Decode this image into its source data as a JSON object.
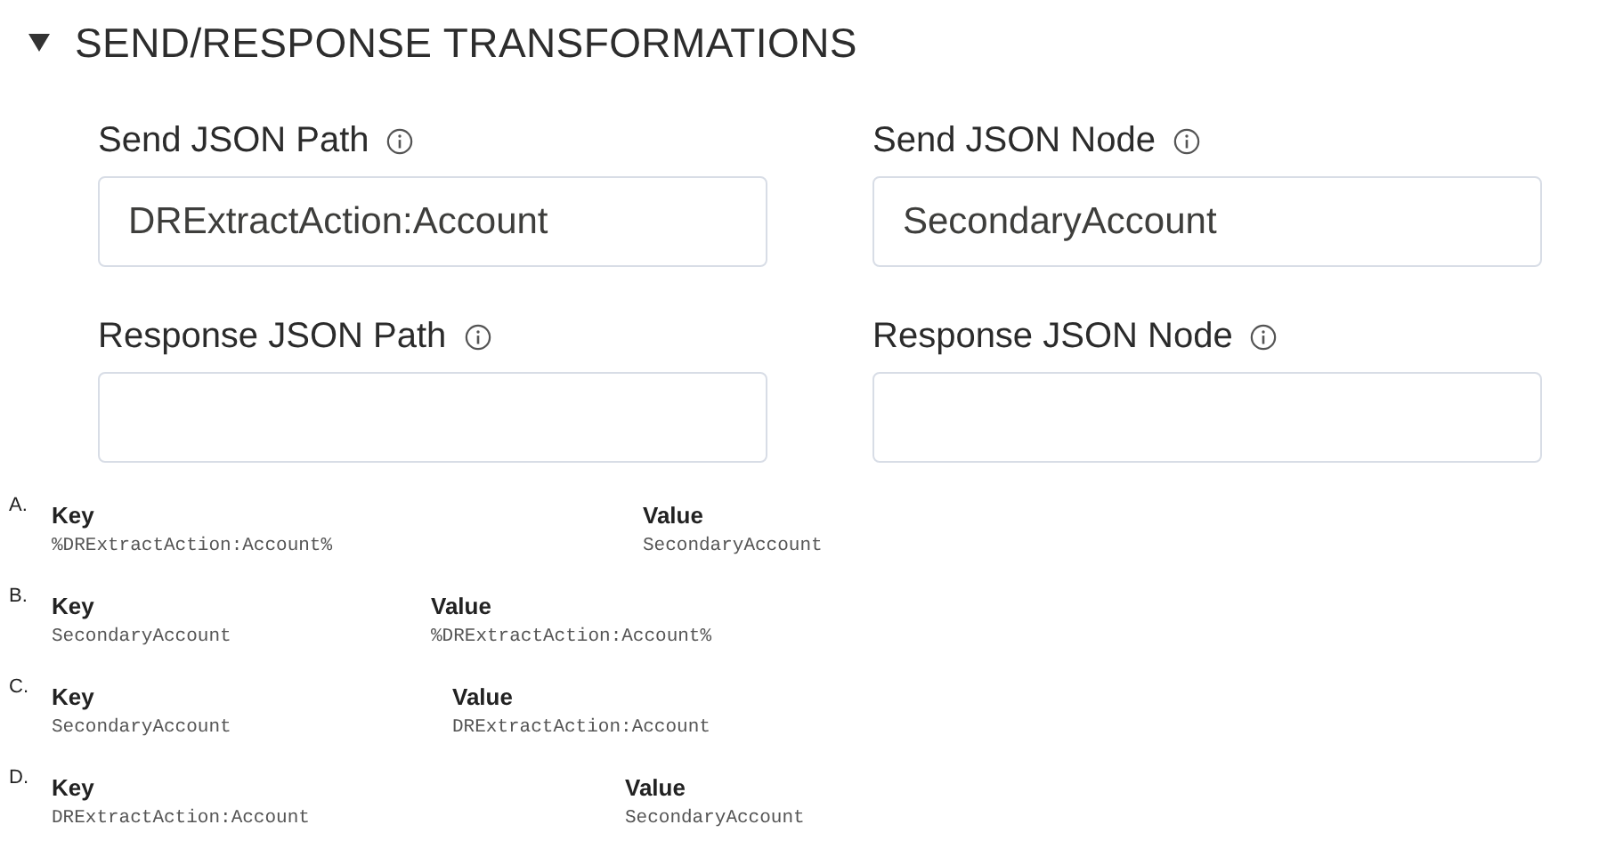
{
  "section": {
    "title": "SEND/RESPONSE TRANSFORMATIONS",
    "expanded": true,
    "fields": [
      {
        "label": "Send JSON Path",
        "value": "DRExtractAction:Account"
      },
      {
        "label": "Send JSON Node",
        "value": "SecondaryAccount"
      },
      {
        "label": "Response JSON Path"
      },
      {
        "label": "Response JSON Node"
      }
    ]
  },
  "options": [
    {
      "letter": "A.",
      "key_heading": "Key",
      "value_heading": "Value",
      "key": "%DRExtractAction:Account%",
      "value": "SecondaryAccount"
    },
    {
      "letter": "B.",
      "key_heading": "Key",
      "value_heading": "Value",
      "key": "SecondaryAccount",
      "value": "%DRExtractAction:Account%"
    },
    {
      "letter": "C.",
      "key_heading": "Key",
      "value_heading": "Value",
      "key": "SecondaryAccount",
      "value": "DRExtractAction:Account"
    },
    {
      "letter": "D.",
      "key_heading": "Key",
      "value_heading": "Value",
      "key": "DRExtractAction:Account",
      "value": "SecondaryAccount"
    }
  ]
}
